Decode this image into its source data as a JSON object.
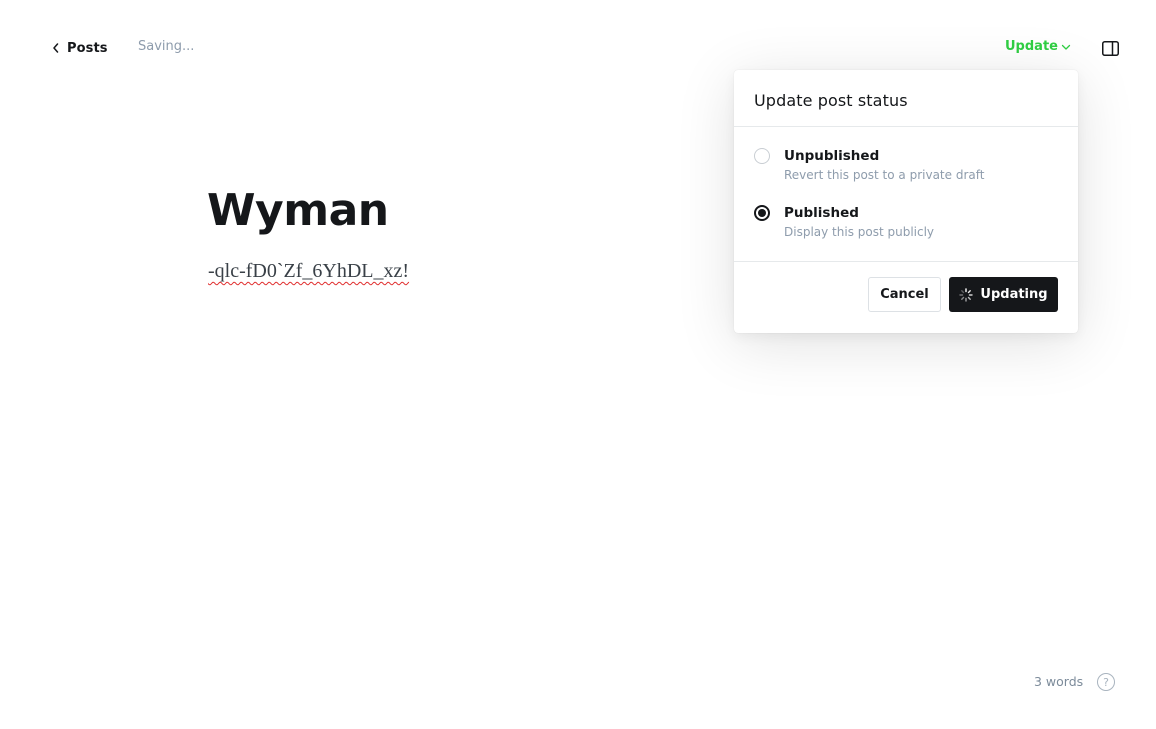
{
  "header": {
    "back_label": "Posts",
    "saving_status": "Saving...",
    "update_label": "Update"
  },
  "post": {
    "title": "Wyman",
    "body": "-qlc-fD0`Zf_6YhDL_xz!"
  },
  "popover": {
    "title": "Update post status",
    "options": [
      {
        "label": "Unpublished",
        "description": "Revert this post to a private draft",
        "selected": false
      },
      {
        "label": "Published",
        "description": "Display this post publicly",
        "selected": true
      }
    ],
    "cancel_label": "Cancel",
    "submit_label": "Updating"
  },
  "footer": {
    "word_count": "3 words",
    "help_symbol": "?"
  },
  "colors": {
    "accent_green": "#30cf43",
    "primary_dark": "#15171a",
    "muted_text": "#8e9cac"
  }
}
